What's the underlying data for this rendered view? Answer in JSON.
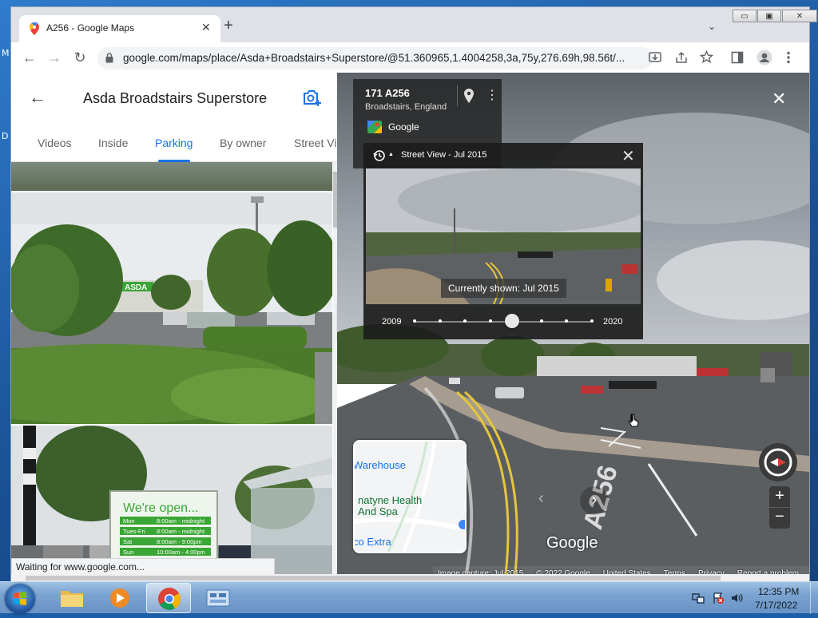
{
  "desktop": {
    "edge_letters": [
      "M",
      "D"
    ]
  },
  "browser": {
    "tab_title": "A256 - Google Maps",
    "tab_close": "✕",
    "new_tab": "+",
    "tab_search": "⌄",
    "window_buttons": {
      "minimize": "▭",
      "maximize": "▣",
      "close": "✕"
    },
    "url": "google.com/maps/place/Asda+Broadstairs+Superstore/@51.360965,1.4004258,3a,75y,276.69h,98.56t/...",
    "nav": {
      "back": "←",
      "forward": "→",
      "reload": "↻"
    }
  },
  "place_panel": {
    "back": "←",
    "title": "Asda Broadstairs Superstore",
    "tabs": [
      "Videos",
      "Inside",
      "Parking",
      "By owner",
      "Street Vi"
    ],
    "active_tab": "Parking",
    "photo1_sign": "ASDA",
    "photo2_sign": {
      "heading": "We're open...",
      "rows": [
        {
          "day": "Mon",
          "hours": "8:00am - midnight"
        },
        {
          "day": "Tues-Fri",
          "hours": "8:00am - midnight"
        },
        {
          "day": "Sat",
          "hours": "8:00am - 9:00pm"
        },
        {
          "day": "Sun",
          "hours": "10:00am - 4:00pm"
        }
      ]
    },
    "collapse": "◀"
  },
  "status_bar": "Waiting for www.google.com...",
  "street_view": {
    "address": "171 A256",
    "city": "Broadstairs, England",
    "more": "⋮",
    "source": "Google",
    "close": "✕",
    "time_machine": {
      "title": "Street View - Jul 2015",
      "close": "✕",
      "current_label": "Currently shown: Jul 2015",
      "start_year": "2009",
      "end_year": "2020",
      "slider_position": 0.55
    },
    "minimap_labels": [
      "Warehouse",
      "natyne Health",
      "And Spa",
      "co Extra"
    ],
    "nav_left": "‹",
    "nav_right": "›",
    "zoom_in": "+",
    "zoom_out": "−",
    "logo": "Google",
    "road_marking": "A256",
    "footer": [
      "Image capture: Jul 2015",
      "© 2022 Google",
      "United States",
      "Terms",
      "Privacy",
      "Report a problem"
    ]
  },
  "taskbar": {
    "clock_time": "12:35 PM",
    "clock_date": "7/17/2022"
  },
  "colors": {
    "accent": "#1a73e8",
    "asda_green": "#3aa635"
  }
}
